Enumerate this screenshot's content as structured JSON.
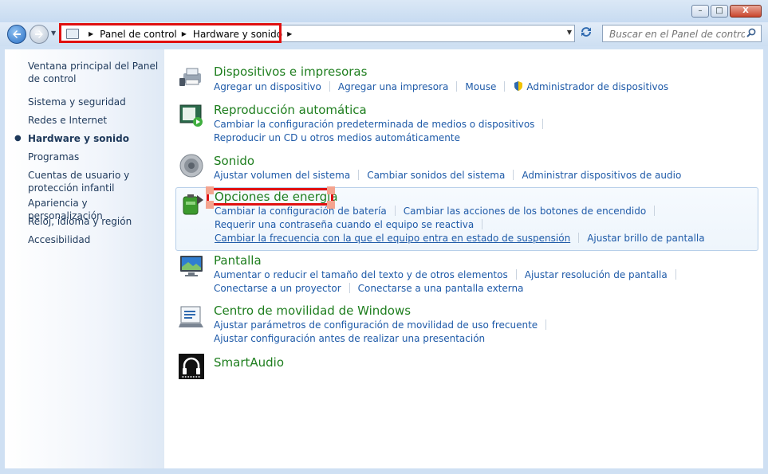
{
  "window": {
    "minimize": "–",
    "maximize": "□",
    "close": "X"
  },
  "address": {
    "crumbs": [
      "Panel de control",
      "Hardware y sonido"
    ]
  },
  "search": {
    "placeholder": "Buscar en el Panel de control"
  },
  "sidebar": {
    "items": [
      "Ventana principal del Panel de control",
      "Sistema y seguridad",
      "Redes e Internet",
      "Hardware y sonido",
      "Programas",
      "Cuentas de usuario y protección infantil",
      "Apariencia y personalización",
      "Reloj, idioma y región",
      "Accesibilidad"
    ],
    "active_index": 3
  },
  "categories": [
    {
      "title": "Dispositivos e impresoras",
      "icon": "printer-devices-icon",
      "rows": [
        [
          "Agregar un dispositivo",
          "Agregar una impresora",
          "Mouse",
          "Administrador de dispositivos"
        ]
      ]
    },
    {
      "title": "Reproducción automática",
      "icon": "autoplay-icon",
      "rows": [
        [
          "Cambiar la configuración predeterminada de medios o dispositivos"
        ],
        [
          "Reproducir un CD u otros medios automáticamente"
        ]
      ]
    },
    {
      "title": "Sonido",
      "icon": "speaker-icon",
      "rows": [
        [
          "Ajustar volumen del sistema",
          "Cambiar sonidos del sistema",
          "Administrar dispositivos de audio"
        ]
      ]
    },
    {
      "title": "Opciones de energía",
      "icon": "power-battery-icon",
      "rows": [
        [
          "Cambiar la configuración de batería",
          "Cambiar las acciones de los botones de encendido"
        ],
        [
          "Requerir una contraseña cuando el equipo se reactiva"
        ],
        [
          "Cambiar la frecuencia con la que el equipo entra en estado de suspensión",
          "Ajustar brillo de pantalla"
        ]
      ]
    },
    {
      "title": "Pantalla",
      "icon": "monitor-icon",
      "rows": [
        [
          "Aumentar o reducir el tamaño del texto y de otros elementos",
          "Ajustar resolución de pantalla"
        ],
        [
          "Conectarse a un proyector",
          "Conectarse a una pantalla externa"
        ]
      ]
    },
    {
      "title": "Centro de movilidad de Windows",
      "icon": "mobility-center-icon",
      "rows": [
        [
          "Ajustar parámetros de configuración de movilidad de uso frecuente"
        ],
        [
          "Ajustar configuración antes de realizar una presentación"
        ]
      ]
    },
    {
      "title": "SmartAudio",
      "icon": "smartaudio-icon",
      "rows": []
    }
  ]
}
